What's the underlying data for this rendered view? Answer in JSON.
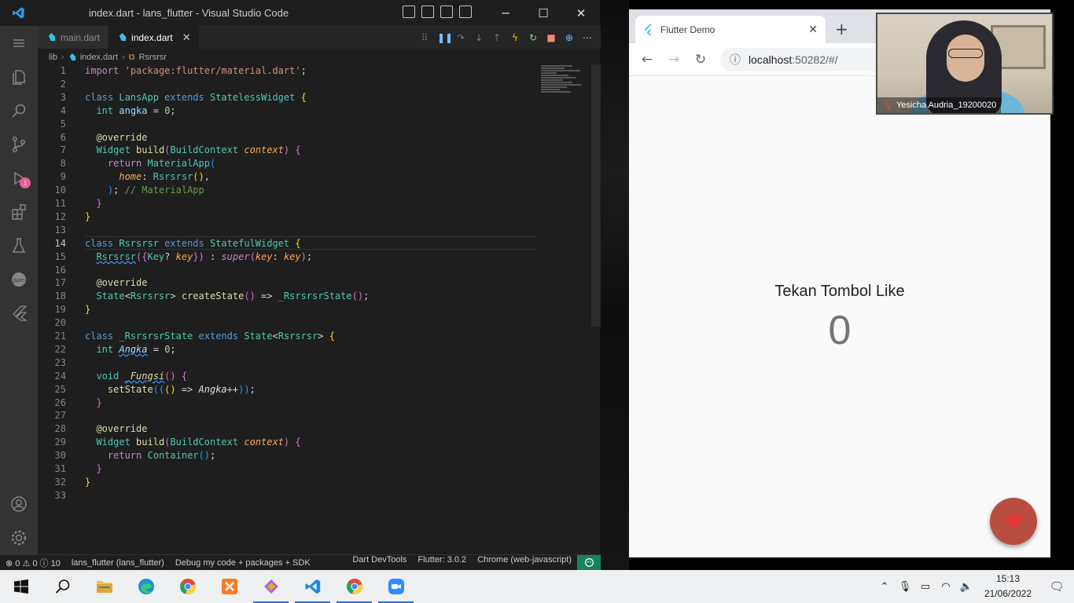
{
  "vscode": {
    "window_title": "index.dart - lans_flutter - Visual Studio Code",
    "tabs": [
      {
        "label": "main.dart",
        "active": false
      },
      {
        "label": "index.dart",
        "active": true
      }
    ],
    "breadcrumb": [
      "lib",
      "index.dart",
      "Rsrsrsr"
    ],
    "activity_badge": "1",
    "code_lines": [
      {
        "n": "1",
        "html": "<span class='kw'>import</span> <span class='str'>'package:flutter/material.dart'</span>;"
      },
      {
        "n": "2",
        "html": ""
      },
      {
        "n": "3",
        "html": "<span class='kw2'>class</span> <span class='ty'>LansApp</span> <span class='kw2'>extends</span> <span class='ty'>StatelessWidget</span> <span class='br1'>{</span>"
      },
      {
        "n": "4",
        "html": "  <span class='ty'>int</span> <span class='var'>angka</span> = <span class='num'>0</span>;"
      },
      {
        "n": "5",
        "html": ""
      },
      {
        "n": "6",
        "html": "  <span class='fn'>@override</span>"
      },
      {
        "n": "7",
        "html": "  <span class='ty'>Widget</span> <span class='fn'>build</span><span class='br2'>(</span><span class='ty'>BuildContext</span> <span class='it' style='color:#ffa657'>context</span><span class='br2'>)</span> <span class='br2'>{</span>"
      },
      {
        "n": "8",
        "html": "    <span class='kw'>return</span> <span class='ty'>MaterialApp</span><span class='br3'>(</span>"
      },
      {
        "n": "9",
        "html": "      <span class='it' style='color:#ffa657'>home</span>: <span class='ty'>Rsrsrsr</span><span class='br1'>()</span>,"
      },
      {
        "n": "10",
        "html": "    <span class='br3'>)</span>; <span class='cm'>// MaterialApp</span>"
      },
      {
        "n": "11",
        "html": "  <span class='br2'>}</span>"
      },
      {
        "n": "12",
        "html": "<span class='br1'>}</span>"
      },
      {
        "n": "13",
        "html": ""
      },
      {
        "n": "14",
        "html": "<span class='kw2'>class</span> <span class='ty'>Rsrsrsr</span> <span class='kw2'>extends</span> <span class='ty'>StatefulWidget</span> <span class='br1'>{</span>"
      },
      {
        "n": "15",
        "html": "  <span class='ty squig'>Rsrsrsr</span><span class='br2'>({</span><span class='ty'>Key</span>? <span class='it' style='color:#ffa657'>key</span><span class='br2'>})</span> : <span class='it' style='color:#c586c0'>super</span><span class='br2'>(</span><span class='it' style='color:#ffa657'>key</span>: <span class='it' style='color:#ffa657'>key</span><span class='br2'>)</span>;"
      },
      {
        "n": "16",
        "html": ""
      },
      {
        "n": "17",
        "html": "  <span class='fn'>@override</span>"
      },
      {
        "n": "18",
        "html": "  <span class='ty'>State</span>&lt;<span class='ty'>Rsrsrsr</span>&gt; <span class='fn'>createState</span><span class='br2'>()</span> =&gt; <span class='ty'>_RsrsrsrState</span><span class='br2'>()</span>;"
      },
      {
        "n": "19",
        "html": "<span class='br1'>}</span>"
      },
      {
        "n": "20",
        "html": ""
      },
      {
        "n": "21",
        "html": "<span class='kw2'>class</span> <span class='ty'>_RsrsrsrState</span> <span class='kw2'>extends</span> <span class='ty'>State</span>&lt;<span class='ty'>Rsrsrsr</span>&gt; <span class='br1'>{</span>"
      },
      {
        "n": "22",
        "html": "  <span class='ty'>int</span> <span class='it squig'>Angka</span> = <span class='num'>0</span>;"
      },
      {
        "n": "23",
        "html": ""
      },
      {
        "n": "24",
        "html": "  <span class='ty'>void</span> <span class='fn squig' style='font-style:italic'>_Fungsi</span><span class='br2'>()</span> <span class='br2'>{</span>"
      },
      {
        "n": "25",
        "html": "    <span class='fn'>setState</span><span class='br3'>((</span><span class='br1'>()</span> =&gt; <span class='it' style='color:#e0e0e0'>Angka</span>++<span class='br3'>))</span>;"
      },
      {
        "n": "26",
        "html": "  <span class='br2'>}</span>"
      },
      {
        "n": "27",
        "html": ""
      },
      {
        "n": "28",
        "html": "  <span class='fn'>@override</span>"
      },
      {
        "n": "29",
        "html": "  <span class='ty'>Widget</span> <span class='fn'>build</span><span class='br2'>(</span><span class='ty'>BuildContext</span> <span class='it' style='color:#ffa657'>context</span><span class='br2'>)</span> <span class='br2'>{</span>"
      },
      {
        "n": "30",
        "html": "    <span class='kw'>return</span> <span class='ty'>Container</span><span class='br3'>()</span>;"
      },
      {
        "n": "31",
        "html": "  <span class='br2'>}</span>"
      },
      {
        "n": "32",
        "html": "<span class='br1'>}</span>"
      },
      {
        "n": "33",
        "html": ""
      }
    ],
    "status": {
      "problems": "⊗ 0 ⚠ 0 ⓘ 10",
      "project": "lans_flutter (lans_flutter)",
      "debug_mode": "Debug my code + packages + SDK",
      "devtools": "Dart DevTools",
      "flutter": "Flutter: 3.0.2",
      "device": "Chrome (web-javascript)"
    }
  },
  "chrome": {
    "tab_title": "Flutter Demo",
    "url_host": "localhost",
    "url_port_path": ":50282/#/",
    "page_label": "Tekan Tombol Like",
    "counter": "0"
  },
  "video": {
    "participant_name": "Yesicha Audria_19200020"
  },
  "taskbar": {
    "time": "15:13",
    "date": "21/06/2022"
  },
  "colors": {
    "fab": "#b84e3f",
    "vscode_bg": "#1e1e1e",
    "accent_blue": "#2a6fc9"
  }
}
